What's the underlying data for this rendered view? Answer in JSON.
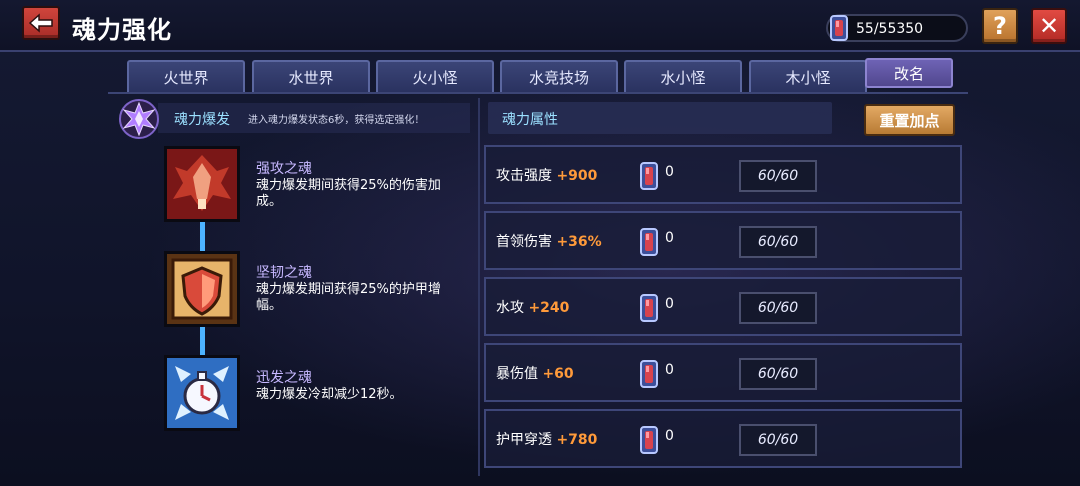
{
  "header": {
    "title": "魂力强化",
    "currency_value": "55/55350",
    "help_label": "?",
    "close_label": "✕"
  },
  "tabs": [
    "火世界",
    "水世界",
    "火小怪",
    "水竞技场",
    "水小怪",
    "木小怪"
  ],
  "rename_label": "改名",
  "burst": {
    "title": "魂力爆发",
    "desc": "进入魂力爆发状态6秒，获得选定强化！"
  },
  "skills": [
    {
      "name": "强攻之魂",
      "desc": "魂力爆发期间获得25%的伤害加成。",
      "icon": "sword-soul-icon"
    },
    {
      "name": "坚韧之魂",
      "desc": "魂力爆发期间获得25%的护甲增幅。",
      "icon": "shield-soul-icon"
    },
    {
      "name": "迅发之魂",
      "desc": "魂力爆发冷却减少12秒。",
      "icon": "clock-soul-icon"
    }
  ],
  "attributes": {
    "header": "魂力属性",
    "reset_label": "重置加点",
    "rows": [
      {
        "name": "攻击强度",
        "bonus": "+900",
        "count": "0",
        "level": "60/60"
      },
      {
        "name": "首领伤害",
        "bonus": "+36%",
        "count": "0",
        "level": "60/60"
      },
      {
        "name": "水攻",
        "bonus": "+240",
        "count": "0",
        "level": "60/60"
      },
      {
        "name": "暴伤值",
        "bonus": "+60",
        "count": "0",
        "level": "60/60"
      },
      {
        "name": "护甲穿透",
        "bonus": "+780",
        "count": "0",
        "level": "60/60"
      }
    ]
  },
  "colors": {
    "accent_cyan": "#9be0ff",
    "bonus_orange": "#ff9a3a",
    "back_red": "#c03a33",
    "help_orange": "#d08a3f"
  }
}
